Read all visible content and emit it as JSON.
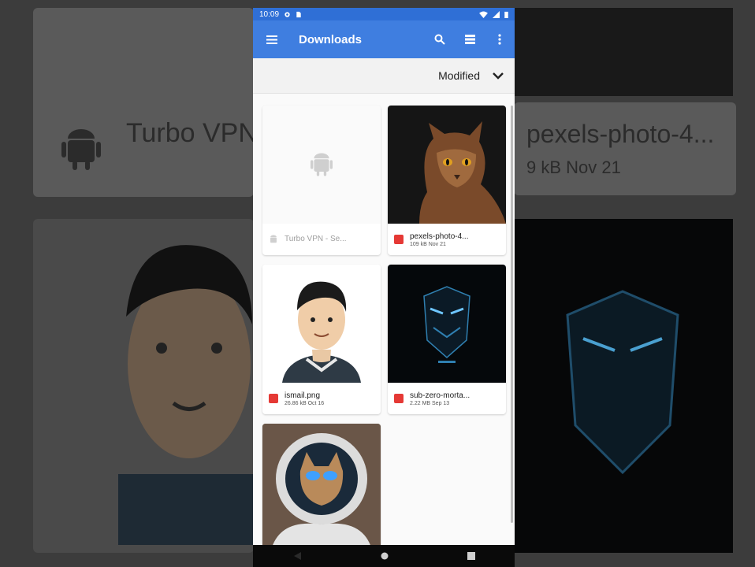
{
  "status_bar": {
    "time": "10:09"
  },
  "app_bar": {
    "title": "Downloads"
  },
  "sort": {
    "label": "Modified"
  },
  "files": [
    {
      "name": "Turbo VPN - Se...",
      "details": ""
    },
    {
      "name": "pexels-photo-4...",
      "details": "109 kB Nov 21"
    },
    {
      "name": "ismail.png",
      "details": "26.86 kB Oct 16"
    },
    {
      "name": "sub-zero-morta...",
      "details": "2.22 MB Sep 13"
    },
    {
      "name": "",
      "details": ""
    }
  ],
  "background": {
    "left_text": "Turbo VPN",
    "right_text": "pexels-photo-4...",
    "right_sub": "9 kB Nov 21"
  },
  "colors": {
    "statusbar": "#2f6fd6",
    "appbar": "#3f7ee0",
    "file_icon": "#e53935"
  }
}
